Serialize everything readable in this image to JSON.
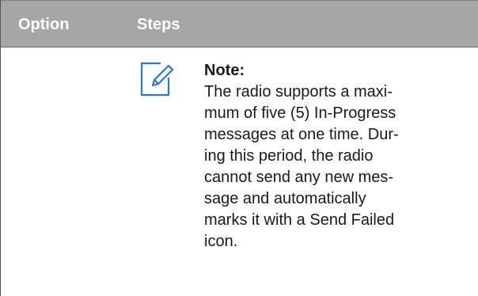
{
  "table": {
    "headers": {
      "option": "Option",
      "steps": "Steps"
    },
    "colors": {
      "header_bg": "#a6a6a6",
      "header_text": "#ffffff",
      "icon_stroke": "#2a79c4"
    }
  },
  "note": {
    "icon": "pencil-note-icon",
    "title": "Note:",
    "lines": [
      "The radio supports a maxi-",
      "mum of five (5) In-Progress",
      "messages at one time. Dur-",
      "ing this period, the radio",
      "cannot send any new mes-",
      "sage and automatically",
      "marks it with a Send Failed",
      "icon."
    ]
  }
}
